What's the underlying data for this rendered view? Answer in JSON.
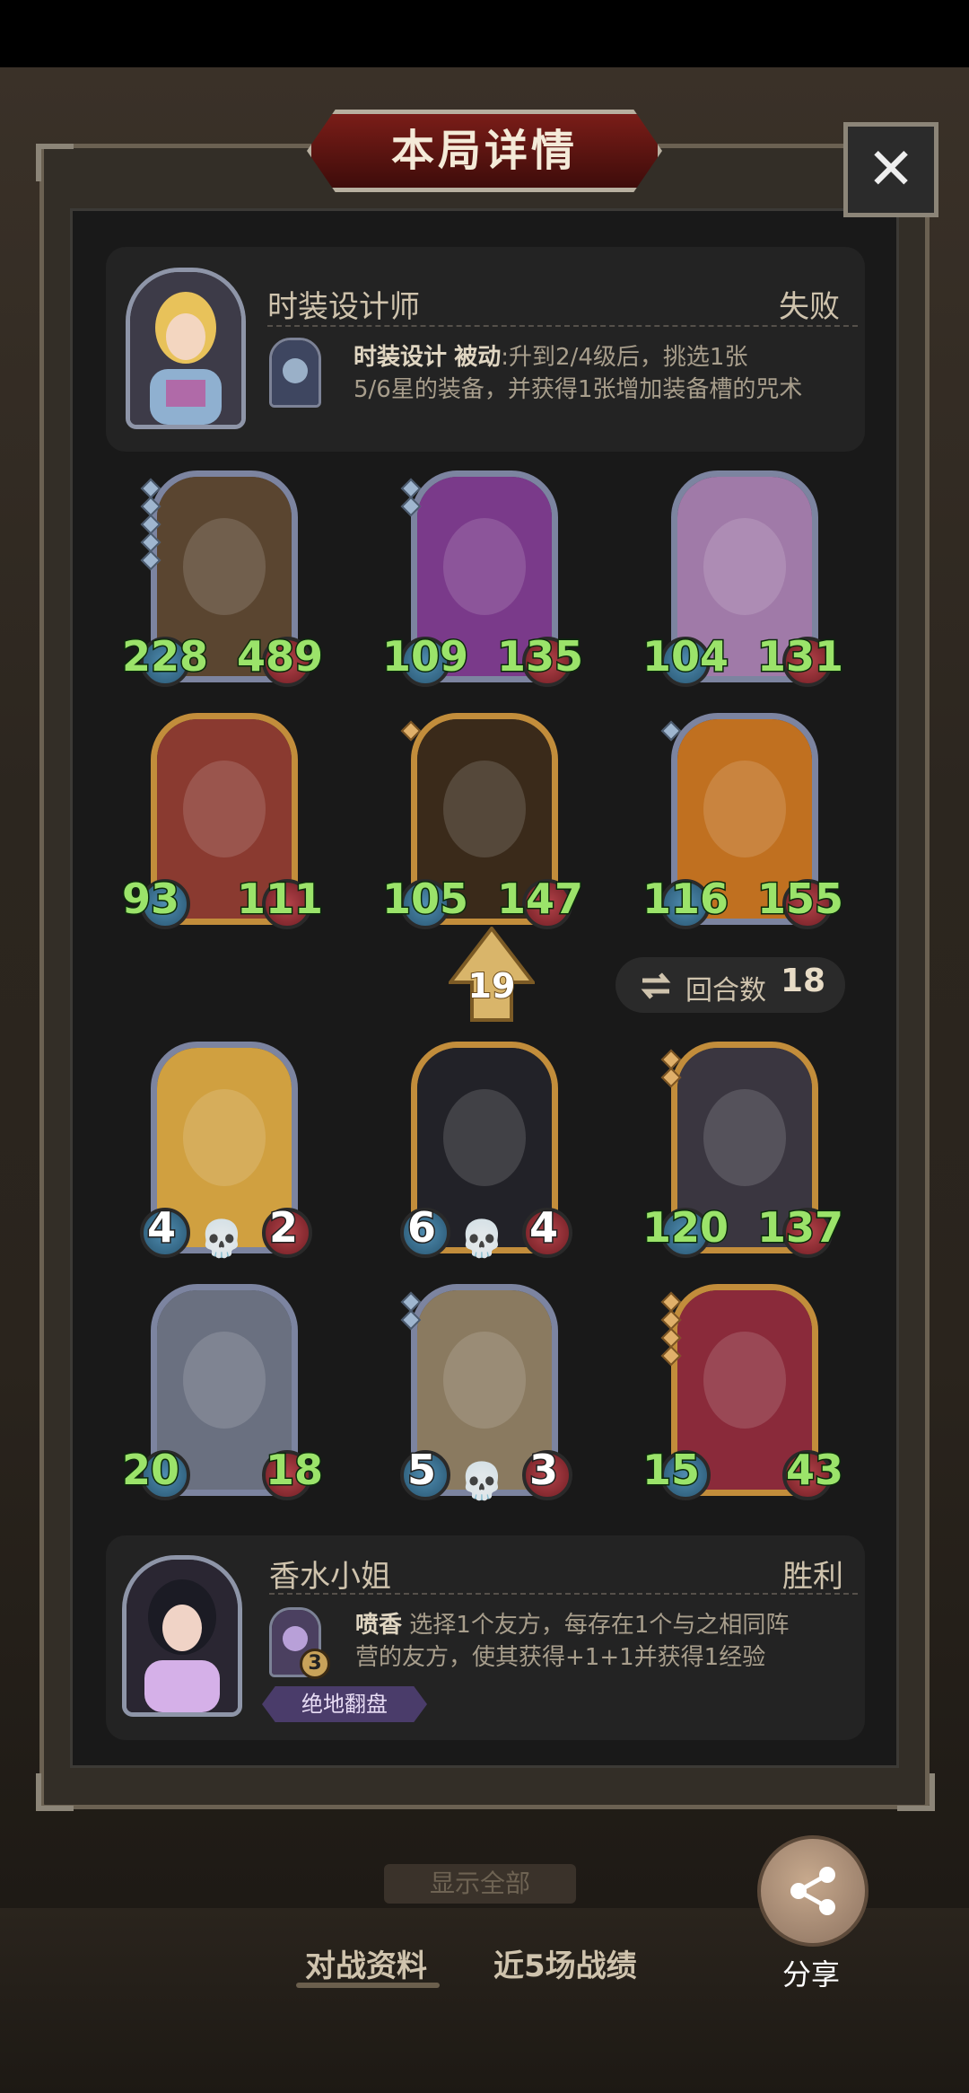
{
  "title": "本局详情",
  "close_label": "✕",
  "opponent": {
    "name": "时装设计师",
    "result": "失败",
    "skill_name": "时装设计",
    "skill_type": "被动",
    "skill_desc_line1": ":升到2/4级后，挑选1张",
    "skill_desc_line2": "5/6星的装备，并获得1张增加装备槽的咒术"
  },
  "opponent_units": [
    {
      "attack": "228",
      "health": "489",
      "frame": "silver",
      "pips": 5
    },
    {
      "attack": "109",
      "health": "135",
      "frame": "silver",
      "pips": 2
    },
    {
      "attack": "104",
      "health": "131",
      "frame": "silver",
      "pips": 0
    },
    {
      "attack": "93",
      "health": "111",
      "frame": "gold",
      "pips": 0
    },
    {
      "attack": "105",
      "health": "147",
      "frame": "gold",
      "pips": 1
    },
    {
      "attack": "116",
      "health": "155",
      "frame": "silver",
      "pips": 1
    }
  ],
  "level": "19",
  "round": {
    "label": "回合数",
    "value": "18"
  },
  "player_units": [
    {
      "attack": "4",
      "health": "2",
      "frame": "silver",
      "pips": 0
    },
    {
      "attack": "6",
      "health": "4",
      "frame": "gold",
      "pips": 0
    },
    {
      "attack": "120",
      "health": "137",
      "frame": "gold",
      "pips": 2
    },
    {
      "attack": "20",
      "health": "18",
      "frame": "silver",
      "pips": 0
    },
    {
      "attack": "5",
      "health": "3",
      "frame": "silver",
      "pips": 2
    },
    {
      "attack": "15",
      "health": "43",
      "frame": "gold",
      "pips": 4
    }
  ],
  "player": {
    "name": "香水小姐",
    "result": "胜利",
    "skill_name": "喷香",
    "skill_desc_line1": "选择1个友方，每存在1个与之相同阵",
    "skill_desc_line2": "营的友方，使其获得+1+1并获得1经验",
    "skill_level": "3",
    "tag": "绝地翻盘"
  },
  "bottom": {
    "show_all": "显示全部",
    "tab_battle": "对战资料",
    "tab_recent": "近5场战绩",
    "share": "分享"
  }
}
